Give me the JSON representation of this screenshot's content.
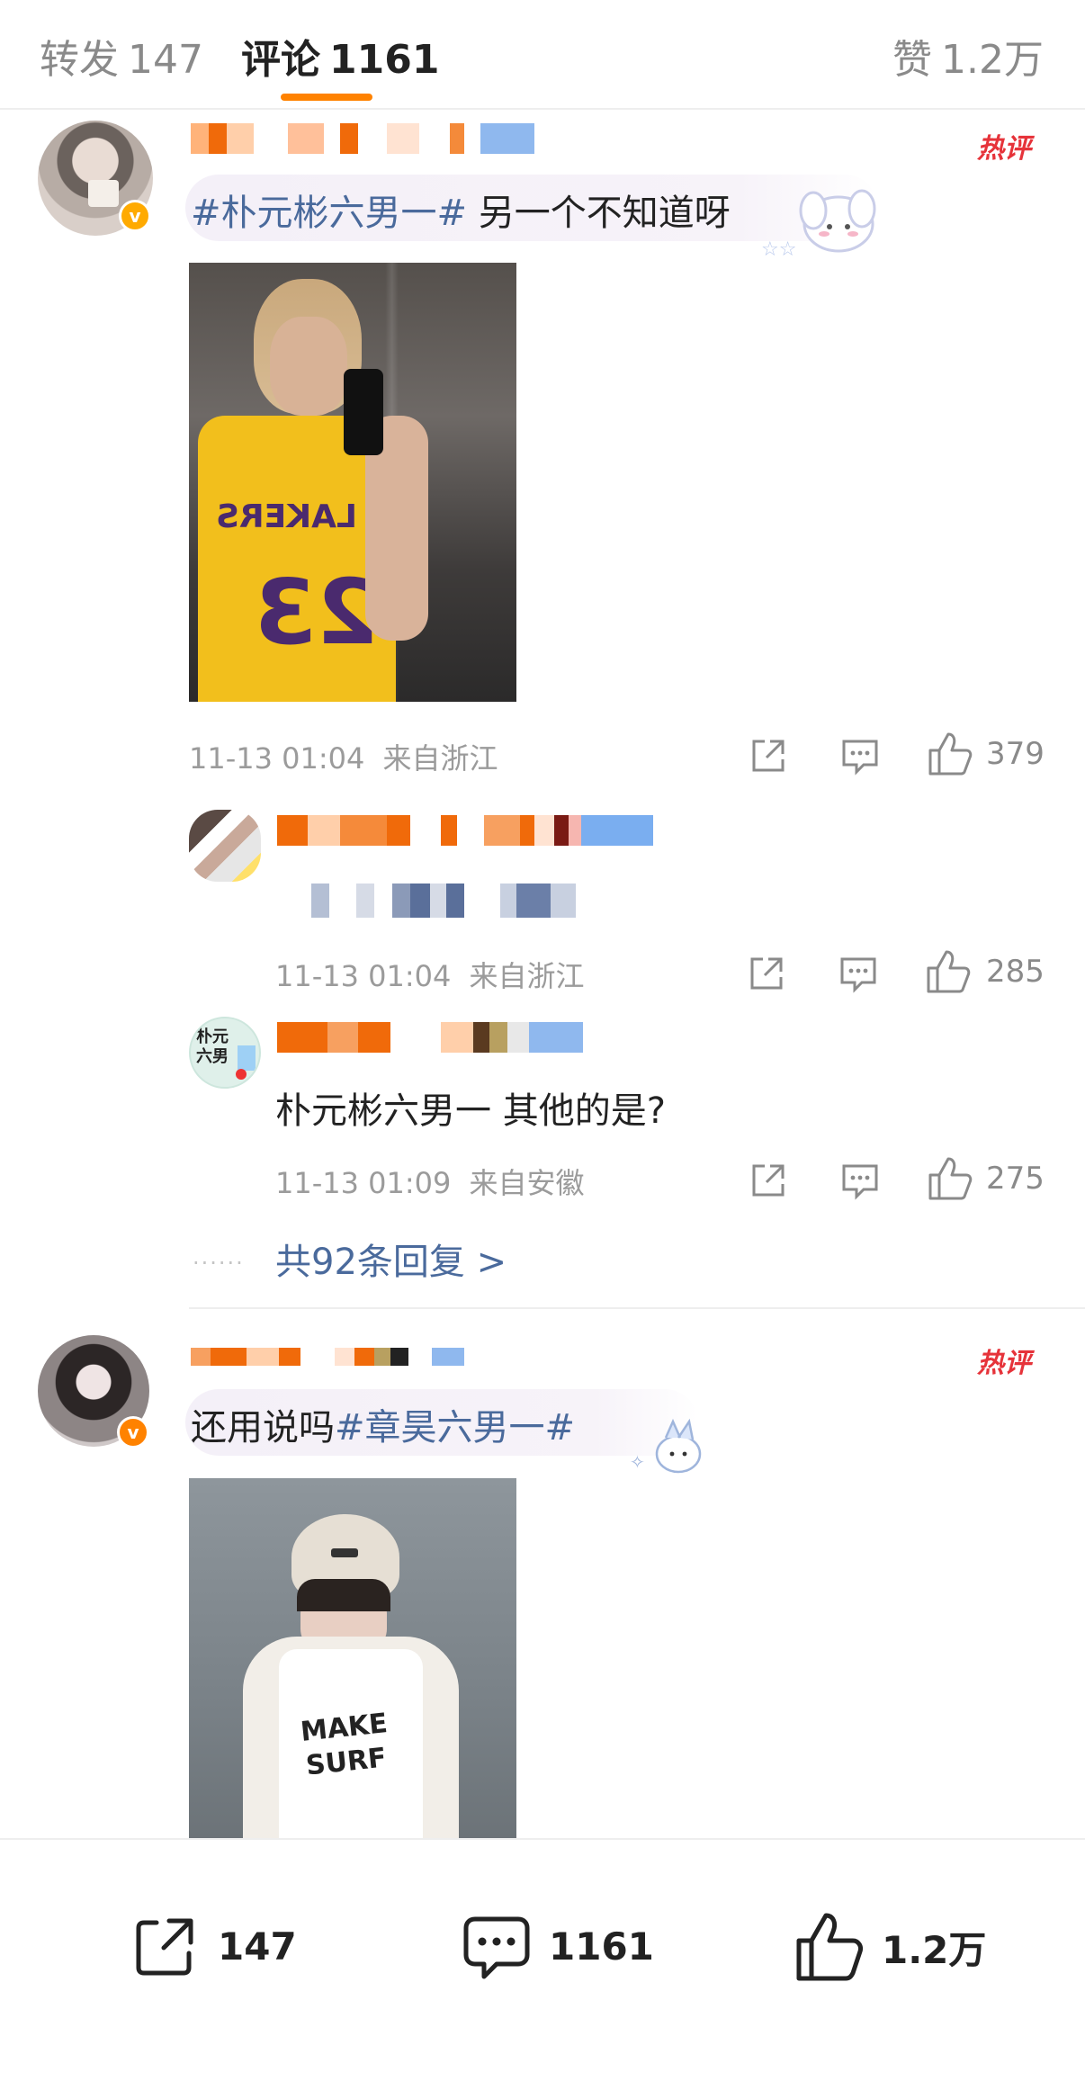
{
  "tabs": {
    "repost_label": "转发",
    "repost_count": "147",
    "comment_label": "评论",
    "comment_count": "1161",
    "like_label": "赞",
    "like_count": "1.2万"
  },
  "hot_badge": "热评",
  "comments": [
    {
      "topic": "#朴元彬六男一#",
      "text": " 另一个不知道呀",
      "verified_badge_color": "#ffaa00",
      "time": "11-13 01:04",
      "location": "来自浙江",
      "likes": "379",
      "replies": [
        {
          "text": "",
          "time": "11-13 01:04",
          "location": "来自浙江",
          "likes": "285"
        },
        {
          "avatar_text": "朴元六男",
          "text": "朴元彬六男一 其他的是?",
          "time": "11-13 01:09",
          "location": "来自安徽",
          "likes": "275"
        }
      ],
      "more_replies": "共92条回复 >",
      "dots": "······"
    },
    {
      "text": "还用说吗",
      "topic": "#章昊六男一#",
      "verified_badge_color": "#ff8200"
    }
  ],
  "bottom_bar": {
    "repost_count": "147",
    "comment_count": "1161",
    "like_count": "1.2万"
  },
  "icons": [
    "share-icon",
    "comment-icon",
    "like-icon",
    "verified-icon"
  ]
}
